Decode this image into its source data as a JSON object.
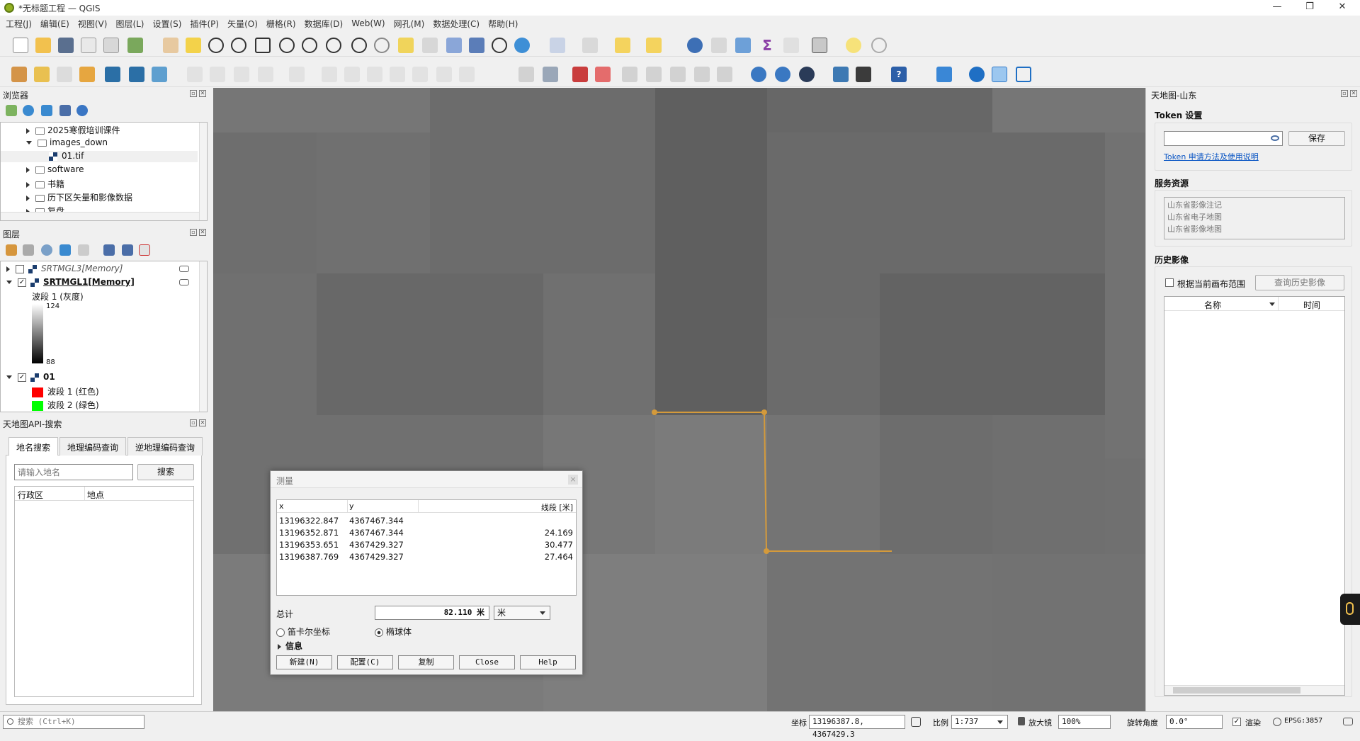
{
  "window": {
    "title": "*无标题工程 — QGIS",
    "minimize": "—",
    "maximize": "❐",
    "close": "✕"
  },
  "menu": [
    "工程(J)",
    "编辑(E)",
    "视图(V)",
    "图层(L)",
    "设置(S)",
    "插件(P)",
    "矢量(O)",
    "栅格(R)",
    "数据库(D)",
    "Web(W)",
    "网孔(M)",
    "数据处理(C)",
    "帮助(H)"
  ],
  "browser": {
    "title": "浏览器",
    "items": [
      "2025寒假培训课件",
      "images_down",
      "01.tif",
      "software",
      "书籍",
      "历下区矢量和影像数据",
      "复盘"
    ]
  },
  "layers": {
    "title": "图层",
    "items": [
      {
        "name": "SRTMGL3[Memory]",
        "checked": false
      },
      {
        "name": "SRTMGL1[Memory]",
        "checked": true
      },
      {
        "name": "01",
        "checked": true
      }
    ],
    "band_gray": "波段 1 (灰度)",
    "gray_max": "124",
    "gray_min": "88",
    "band_red": "波段 1 (红色)",
    "band_green": "波段 2 (绿色)",
    "red_color": "#ff0000",
    "green_color": "#00ff00"
  },
  "tianditu_search": {
    "title": "天地图API-搜索",
    "tabs": [
      "地名搜索",
      "地理编码查询",
      "逆地理编码查询"
    ],
    "placeholder": "请输入地名",
    "search_btn": "搜索",
    "col_region": "行政区",
    "col_place": "地点"
  },
  "measure": {
    "title": "测量",
    "close": "×",
    "col_x": "x",
    "col_y": "y",
    "col_seg": "线段 [米]",
    "rows": [
      {
        "x": "13196322.847",
        "y": "4367467.344",
        "seg": ""
      },
      {
        "x": "13196352.871",
        "y": "4367467.344",
        "seg": "24.169"
      },
      {
        "x": "13196353.651",
        "y": "4367429.327",
        "seg": "30.477"
      },
      {
        "x": "13196387.769",
        "y": "4367429.327",
        "seg": "27.464"
      }
    ],
    "total_label": "总计",
    "total_value": "82.110 米",
    "unit": "米",
    "cartesian": "笛卡尔坐标",
    "ellipsoid": "椭球体",
    "info": "信息",
    "btn_new": "新建(N)",
    "btn_config": "配置(C)",
    "btn_copy": "复制",
    "btn_close": "Close",
    "btn_help": "Help",
    "line_color": "#d49a3b"
  },
  "right_panel": {
    "title": "天地图-山东",
    "token_title": "Token 设置",
    "save_btn": "保存",
    "token_link": "Token 申请方法及使用说明",
    "services_title": "服务资源",
    "services": [
      "山东省影像注记",
      "山东省电子地图",
      "山东省影像地图"
    ],
    "history_title": "历史影像",
    "by_canvas": "根据当前画布范围",
    "query_btn": "查询历史影像",
    "col_name": "名称",
    "col_time": "时间"
  },
  "status": {
    "search_placeholder": "搜索 (Ctrl+K)",
    "coord_label": "坐标",
    "coord_value": "13196387.8, 4367429.3",
    "scale_label": "比例",
    "scale_value": "1:737",
    "magnifier_label": "放大镜",
    "magnifier_value": "100%",
    "rotation_label": "旋转角度",
    "rotation_value": "0.0°",
    "render_label": "渲染",
    "crs": "EPSG:3857"
  }
}
